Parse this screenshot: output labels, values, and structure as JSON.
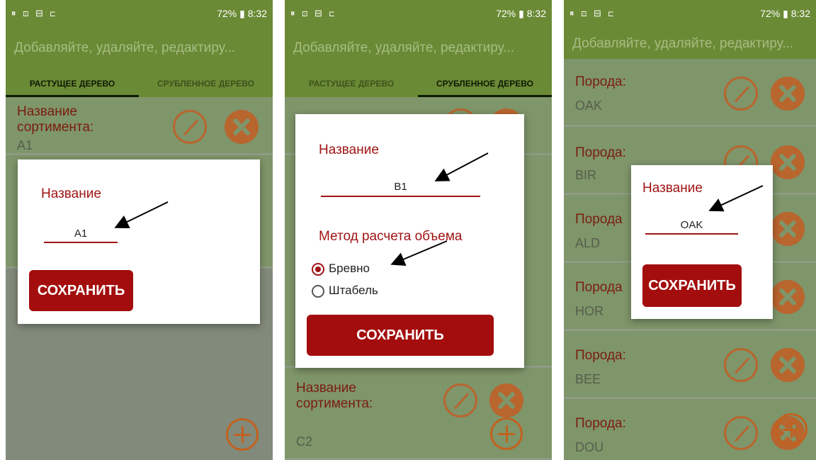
{
  "status_bar": {
    "left_icons": "⏸ ⊡ ⊟ ⊏",
    "battery": "72%",
    "time": "8:32"
  },
  "app_title": "Добавляйте, удаляйте, редактиру...",
  "tabs": {
    "growing": "РАСТУЩЕЕ ДЕРЕВО",
    "felled": "СРУБЛЕННОЕ ДЕРЕВО"
  },
  "screen1": {
    "row_label": "Название сортимента:",
    "row_value": "A1",
    "dialog": {
      "title": "Название",
      "input_value": "A1",
      "save": "СОХРАНИТЬ"
    }
  },
  "screen2": {
    "row_label": "Название сортимента:",
    "row_value": "C2",
    "dialog": {
      "title": "Название",
      "input_value": "B1",
      "method_title": "Метод расчета объема",
      "options": [
        "Бревно",
        "Штабель"
      ],
      "selected": "Бревно",
      "save": "СОХРАНИТЬ"
    }
  },
  "screen3": {
    "rows": [
      {
        "label": "Порода:",
        "value": "OAK"
      },
      {
        "label": "Порода:",
        "value": "BIR"
      },
      {
        "label": "Порода",
        "value": "ALD"
      },
      {
        "label": "Порода",
        "value": "HOR"
      },
      {
        "label": "Порода:",
        "value": "BEE"
      },
      {
        "label": "Порода:",
        "value": "DOU"
      }
    ],
    "dialog": {
      "title": "Название",
      "input_value": "OAK",
      "save": "СОХРАНИТЬ"
    }
  },
  "colors": {
    "appbar": "#6b8a35",
    "accent_red": "#a30d0d",
    "icon_orange": "#b9652e"
  },
  "icons": [
    "edit-icon",
    "delete-icon",
    "add-icon",
    "annotation-arrow"
  ]
}
